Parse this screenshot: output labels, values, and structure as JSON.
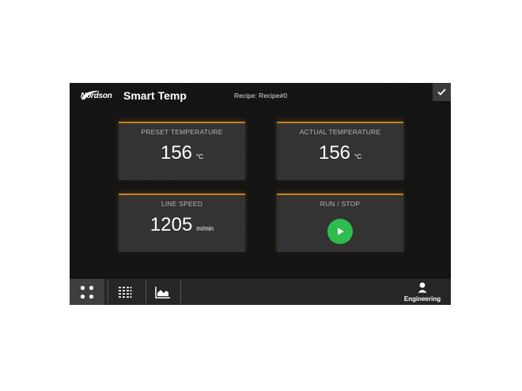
{
  "header": {
    "logo_text": "Nordson",
    "app_title": "Smart Temp",
    "recipe": "Recipe: Recipe#0",
    "confirm_icon": "check-icon"
  },
  "cards": {
    "preset_temperature": {
      "label": "PRESET TEMPERATURE",
      "value": "156",
      "unit": "°C"
    },
    "actual_temperature": {
      "label": "ACTUAL TEMPERATURE",
      "value": "156",
      "unit": "°C"
    },
    "line_speed": {
      "label": "LINE SPEED",
      "value": "1205",
      "unit": "m/min"
    },
    "run_stop": {
      "label": "RUN / STOP",
      "icon": "play-icon",
      "color": "#2dbd4e"
    }
  },
  "nav": {
    "items": [
      {
        "name": "dashboard",
        "icon": "grid-dots-icon",
        "active": true
      },
      {
        "name": "zones",
        "icon": "list-grid-icon",
        "active": false
      },
      {
        "name": "trend",
        "icon": "chart-icon",
        "active": false
      }
    ],
    "user_label": "Engineering",
    "user_icon": "user-icon"
  },
  "colors": {
    "accent": "#c9801e",
    "background": "#141414",
    "card": "#333333",
    "run": "#2dbd4e"
  }
}
